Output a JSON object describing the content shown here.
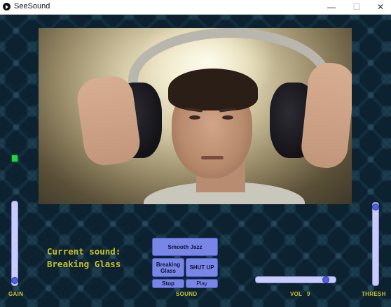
{
  "window": {
    "title": "SeeSound",
    "minimize_glyph": "—",
    "maximize_glyph": "☐",
    "close_glyph": "✕"
  },
  "status": {
    "current_label": "Current sound:",
    "current_value": "Breaking Glass",
    "indicator_color": "#22d444"
  },
  "buttons": {
    "smooth_jazz": "Smooth Jazz",
    "breaking_glass": "Breaking Glass",
    "shut_up": "SHUT UP",
    "stop": "Stop",
    "play": "Play"
  },
  "labels": {
    "gain": "GAIN",
    "sound": "SOUND",
    "vol": "VOL",
    "vol_value": "9",
    "thresh": "THRESH"
  },
  "controls": {
    "gain_level": 0.04,
    "thresh_level": 0.99,
    "vol_level": 0.9
  },
  "colors": {
    "accent": "#7a86e6",
    "label": "#c8c02a",
    "background": "#0c2231"
  }
}
